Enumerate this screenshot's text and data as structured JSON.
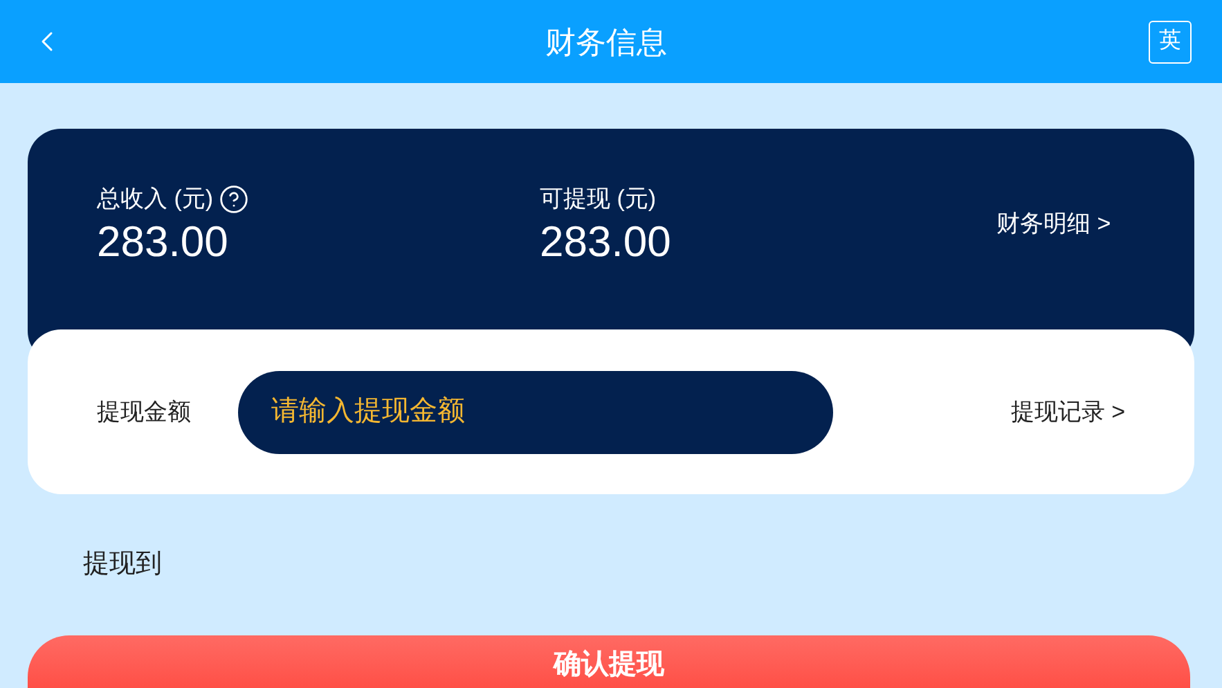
{
  "header": {
    "title": "财务信息",
    "language_button": "英"
  },
  "summary": {
    "total_income": {
      "label": "总收入 (元)",
      "value": "283.00"
    },
    "withdrawable": {
      "label": "可提现 (元)",
      "value": "283.00"
    },
    "details_link": "财务明细 >"
  },
  "withdraw": {
    "label": "提现金额",
    "placeholder": "请输入提现金额",
    "records_link": "提现记录 >"
  },
  "withdraw_to": {
    "label": "提现到"
  },
  "confirm_button": "确认提现"
}
